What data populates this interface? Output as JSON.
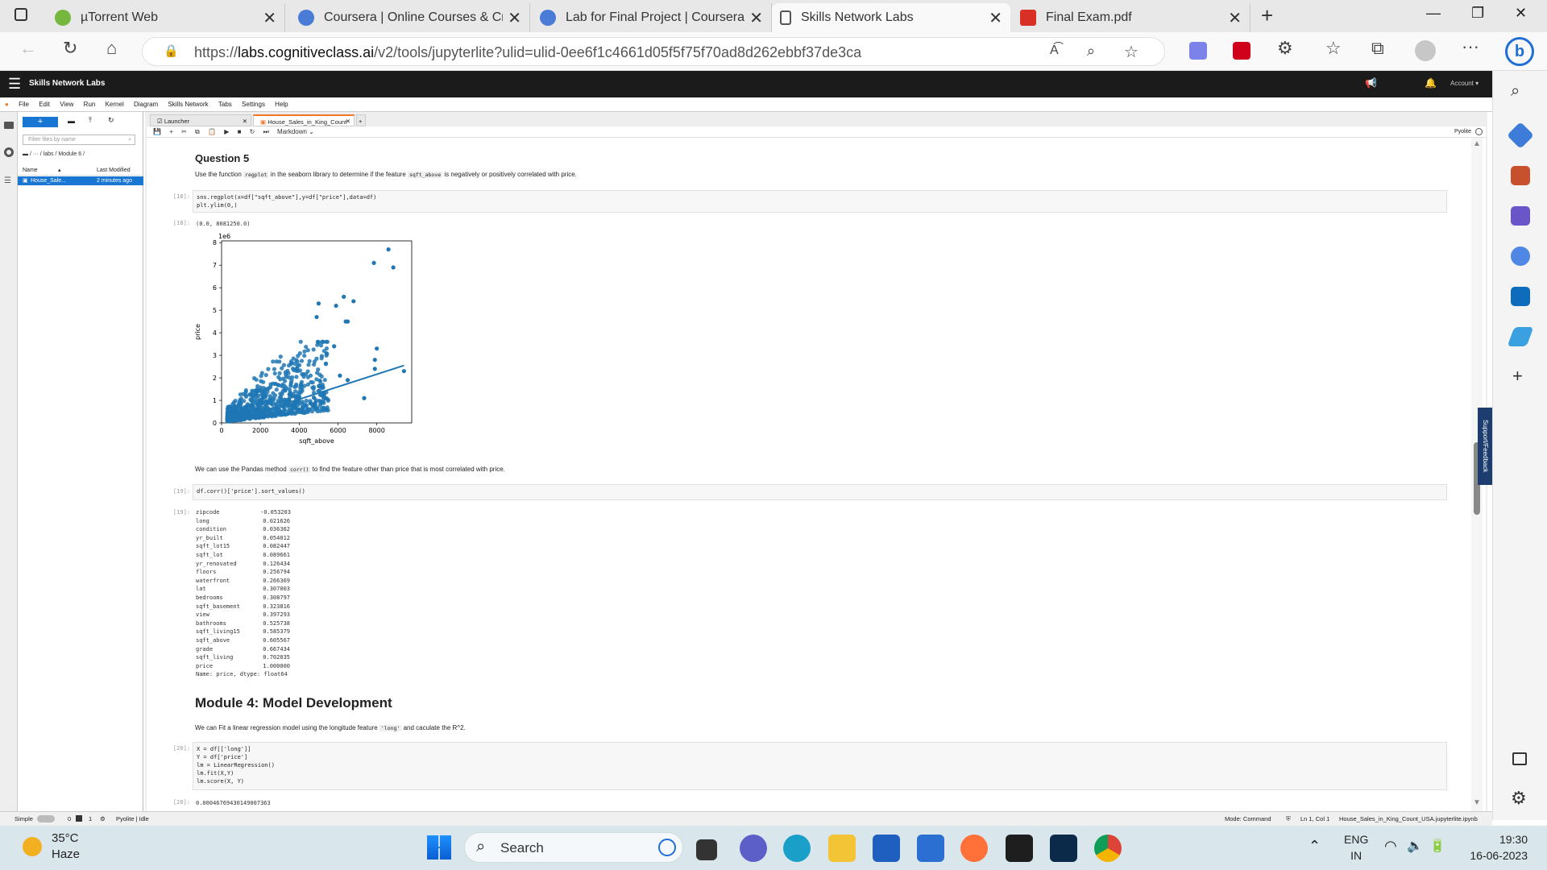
{
  "browser": {
    "tabs": [
      {
        "title": "µTorrent Web",
        "color": "#76b83f"
      },
      {
        "title": "Coursera | Online Courses & Cre",
        "color": "#4a7bd6"
      },
      {
        "title": "Lab for Final Project | Coursera",
        "color": "#4a7bd6"
      },
      {
        "title": "Skills Network Labs",
        "color": "#ffffff"
      },
      {
        "title": "Final Exam.pdf",
        "color": "#d93025"
      }
    ],
    "url_prefix": "https://",
    "url_host": "labs.cognitiveclass.ai",
    "url_path": "/v2/tools/jupyterlite?ulid=ulid-0ee6f1c4661d05f5f75f70ad8d262ebbf37de3ca"
  },
  "jupyter": {
    "brand": "Skills Network Labs",
    "account": "Account",
    "menu": [
      "File",
      "Edit",
      "View",
      "Run",
      "Kernel",
      "Diagram",
      "Skills Network",
      "Tabs",
      "Settings",
      "Help"
    ],
    "filter_placeholder": "Filter files by name",
    "breadcrumb": "/ ··· / labs / Module 6 /",
    "col_name": "Name",
    "col_modified": "Last Modified",
    "file_name": "House_Sale...",
    "file_modified": "2 minutes ago",
    "doc_tabs": [
      "Launcher",
      "House_Sales_in_King_Count"
    ],
    "cell_type": "Markdown",
    "kernel": "Pyolite"
  },
  "notebook": {
    "q5_heading": "Question 5",
    "q5_text_a": "Use the function",
    "q5_code_a": "regplot",
    "q5_text_b": "in the seaborn library to determine if the feature",
    "q5_code_b": "sqft_above",
    "q5_text_c": "is negatively or positively correlated with price.",
    "cell18_prompt": "[18]:",
    "cell18_code": "sns.regplot(x=df[\"sqft_above\"],y=df[\"price\"],data=df)\nplt.ylim(0,)",
    "out18_prompt": "[18]:",
    "out18_text": "(0.0, 8081250.0)",
    "corr_text_a": "We can use the Pandas method",
    "corr_code": "corr()",
    "corr_text_b": "to find the feature other than price that is most correlated with price.",
    "cell19_prompt": "[19]:",
    "cell19_code": "df.corr()['price'].sort_values()",
    "out19_prompt": "[19]:",
    "corr_rows": [
      [
        "zipcode",
        "-0.053203"
      ],
      [
        "long",
        "0.021626"
      ],
      [
        "condition",
        "0.036362"
      ],
      [
        "yr_built",
        "0.054012"
      ],
      [
        "sqft_lot15",
        "0.082447"
      ],
      [
        "sqft_lot",
        "0.089661"
      ],
      [
        "yr_renovated",
        "0.126434"
      ],
      [
        "floors",
        "0.256794"
      ],
      [
        "waterfront",
        "0.266369"
      ],
      [
        "lat",
        "0.307003"
      ],
      [
        "bedrooms",
        "0.308797"
      ],
      [
        "sqft_basement",
        "0.323816"
      ],
      [
        "view",
        "0.397293"
      ],
      [
        "bathrooms",
        "0.525738"
      ],
      [
        "sqft_living15",
        "0.585379"
      ],
      [
        "sqft_above",
        "0.605567"
      ],
      [
        "grade",
        "0.667434"
      ],
      [
        "sqft_living",
        "0.702035"
      ],
      [
        "price",
        "1.000000"
      ]
    ],
    "corr_footer": "Name: price, dtype: float64",
    "module4_heading": "Module 4: Model Development",
    "m4_text_a": "We can Fit a linear regression model using the longitude feature",
    "m4_code": "'long'",
    "m4_text_b": "and caculate the R^2.",
    "cell20_prompt": "[20]:",
    "cell20_code": "X = df[['long']]\nY = df['price']\nlm = LinearRegression()\nlm.fit(X,Y)\nlm.score(X, Y)",
    "out20_prompt": "[20]:",
    "out20_text": "0.00046769430149007363"
  },
  "chart_data": {
    "type": "scatter",
    "multiplier_label": "1e6",
    "xlabel": "sqft_above",
    "ylabel": "price",
    "xlim": [
      0,
      9800
    ],
    "ylim": [
      0,
      8.08
    ],
    "x_ticks": [
      0,
      2000,
      4000,
      6000,
      8000
    ],
    "y_ticks": [
      0,
      1,
      2,
      3,
      4,
      5,
      6,
      7,
      8
    ],
    "regression_line": {
      "x": [
        300,
        9400
      ],
      "y": [
        0.02,
        2.55
      ]
    },
    "outliers": [
      {
        "x": 7850,
        "y": 7.1
      },
      {
        "x": 8600,
        "y": 7.7
      },
      {
        "x": 8850,
        "y": 6.9
      },
      {
        "x": 6800,
        "y": 5.4
      },
      {
        "x": 6300,
        "y": 5.6
      },
      {
        "x": 6400,
        "y": 4.5
      },
      {
        "x": 6500,
        "y": 4.5
      },
      {
        "x": 5900,
        "y": 5.2
      },
      {
        "x": 5000,
        "y": 5.3
      },
      {
        "x": 4900,
        "y": 4.7
      },
      {
        "x": 8000,
        "y": 3.3
      },
      {
        "x": 7900,
        "y": 2.8
      },
      {
        "x": 7900,
        "y": 2.4
      },
      {
        "x": 9400,
        "y": 2.3
      },
      {
        "x": 7350,
        "y": 1.1
      },
      {
        "x": 5800,
        "y": 3.4
      },
      {
        "x": 6500,
        "y": 1.9
      },
      {
        "x": 6100,
        "y": 2.1
      }
    ],
    "point_color": "#1f77b4"
  },
  "status": {
    "mode_simple": "Simple",
    "count_a": "0",
    "count_b": "1",
    "kernel_status": "Pyolite | Idle",
    "mode": "Mode: Command",
    "position": "Ln 1, Col 1",
    "file": "House_Sales_in_King_Count_USA.jupyterlite.ipynb"
  },
  "side_feedback": "Support/Feedback",
  "taskbar": {
    "temp": "35°C",
    "weather": "Haze",
    "search": "Search",
    "lang_a": "ENG",
    "lang_b": "IN",
    "time": "19:30",
    "date": "16-06-2023"
  }
}
